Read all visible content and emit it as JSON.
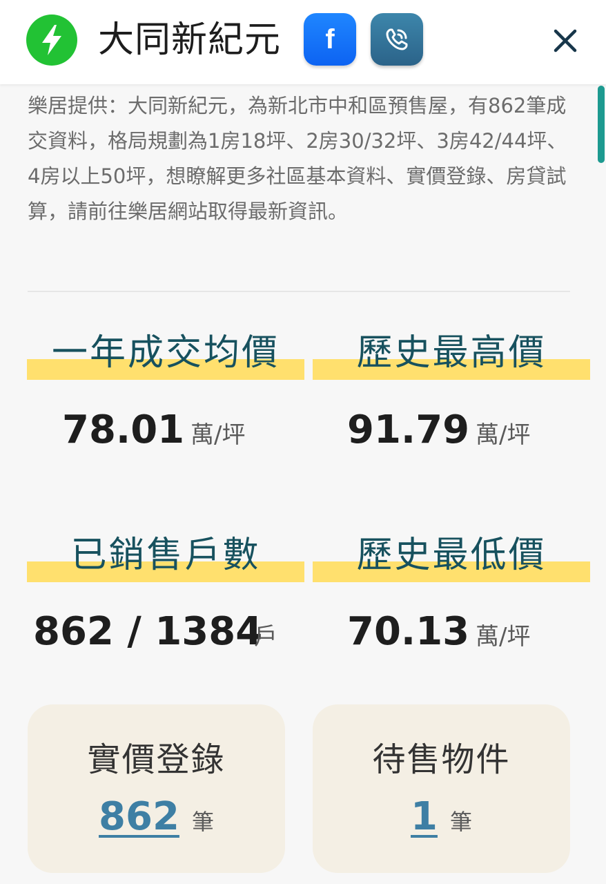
{
  "header": {
    "title": "大同新紀元",
    "logo_icon": "lightning-bolt-icon",
    "facebook_label": "f",
    "phone_icon": "phone-call-icon",
    "close_icon": "close-icon"
  },
  "description": "樂居提供：大同新紀元，為新北市中和區預售屋，有862筆成交資料，格局規劃為1房18坪、2房30/32坪、3房42/44坪、4房以上50坪，想瞭解更多社區基本資料、實價登錄、房貸試算，請前往樂居網站取得最新資訊。",
  "stats": {
    "avg_price": {
      "label": "一年成交均價",
      "value": "78.01",
      "unit": "萬/坪"
    },
    "max_price": {
      "label": "歷史最高價",
      "value": "91.79",
      "unit": "萬/坪"
    },
    "sold_units": {
      "label": "已銷售戶數",
      "value": "862 / 1384",
      "unit": "戶"
    },
    "min_price": {
      "label": "歷史最低價",
      "value": "70.13",
      "unit": "萬/坪"
    }
  },
  "cards": {
    "transactions": {
      "title": "實價登錄",
      "count": "862",
      "unit": "筆"
    },
    "for_sale": {
      "title": "待售物件",
      "count": "1",
      "unit": "筆"
    }
  },
  "colors": {
    "logo": "#22c234",
    "facebook": "#1877f2",
    "phone": "#2f6f95",
    "heading_text": "#17515e",
    "highlight": "#ffe06e",
    "card_bg": "#f4efe4",
    "link": "#3e7fa4",
    "scrollbar": "#1d9a90"
  }
}
